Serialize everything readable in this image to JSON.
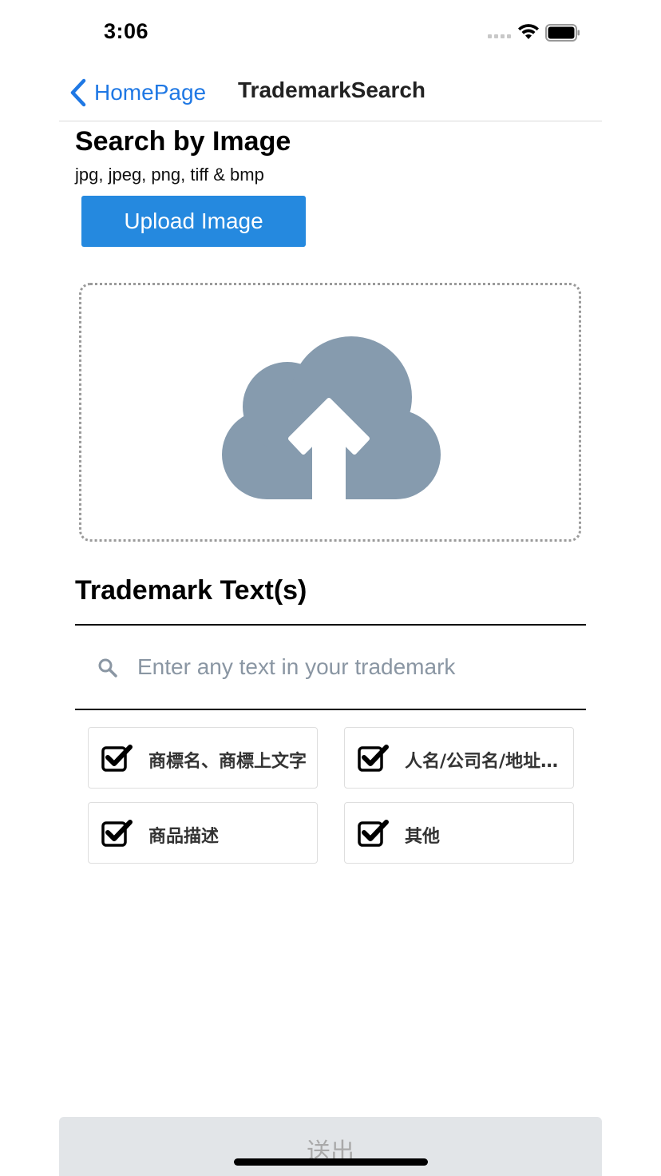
{
  "status_bar": {
    "time": "3:06",
    "icons": [
      "signal-icon",
      "wifi-icon",
      "battery-icon"
    ]
  },
  "nav": {
    "back_label": "HomePage",
    "title": "TrademarkSearch",
    "accent_color": "#1f78e4"
  },
  "image_search": {
    "title": "Search by Image",
    "formats": "jpg, jpeg, png, tiff & bmp",
    "upload_label": "Upload Image",
    "upload_color": "#2589df",
    "dropzone_icon": "cloud-upload-icon",
    "icon_color": "#869bae"
  },
  "text_search": {
    "title": "Trademark Text(s)",
    "input_value": "",
    "placeholder": "Enter any text in your trademark"
  },
  "filters": [
    {
      "label": "商標名、商標上文字",
      "checked": true
    },
    {
      "label": "人名/公司名/地址…",
      "checked": true
    },
    {
      "label": "商品描述",
      "checked": true
    },
    {
      "label": "其他",
      "checked": true
    }
  ],
  "submit": {
    "label": "送出",
    "enabled": false
  }
}
